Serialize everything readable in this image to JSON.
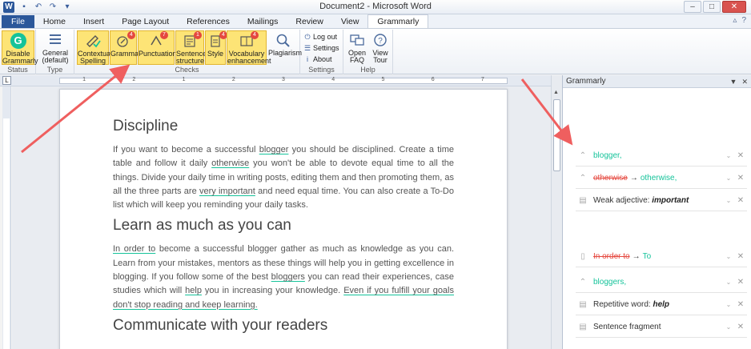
{
  "window": {
    "title": "Document2 - Microsoft Word",
    "app_icon": "W",
    "min": "–",
    "max": "□",
    "close": "✕"
  },
  "tabs": [
    "File",
    "Home",
    "Insert",
    "Page Layout",
    "References",
    "Mailings",
    "Review",
    "View",
    "Grammarly"
  ],
  "ribbon": {
    "status": {
      "label": "Status",
      "button": "Disable Grammarly",
      "button_l1": "Disable",
      "button_l2": "Grammarly"
    },
    "type": {
      "label": "Type",
      "button_l1": "General",
      "button_l2": "(default)"
    },
    "checks": {
      "label": "Checks",
      "buttons": [
        {
          "l1": "Contextual",
          "l2": "Spelling",
          "badge": ""
        },
        {
          "l1": "Grammar",
          "l2": "",
          "badge": "4"
        },
        {
          "l1": "Punctuation",
          "l2": "",
          "badge": "7"
        },
        {
          "l1": "Sentence",
          "l2": "structure",
          "badge": "1"
        },
        {
          "l1": "Style",
          "l2": "",
          "badge": "4"
        },
        {
          "l1": "Vocabulary",
          "l2": "enhancement",
          "badge": "4"
        },
        {
          "l1": "Plagiarism",
          "l2": "",
          "badge": ""
        }
      ]
    },
    "settings": {
      "label": "Settings",
      "items": [
        "Log out",
        "Settings",
        "About"
      ]
    },
    "help": {
      "label": "Help",
      "buttons": [
        {
          "l1": "Open",
          "l2": "FAQ"
        },
        {
          "l1": "View",
          "l2": "Tour"
        }
      ]
    }
  },
  "ruler_numbers": [
    "1",
    "2",
    "1",
    "2",
    "3",
    "4",
    "5",
    "6",
    "7"
  ],
  "document": {
    "h1": "Discipline",
    "p1": {
      "a": "If you want to become a successful ",
      "u1": "blogger",
      "b": " you should be disciplined. Create a time table and follow it daily ",
      "u2": "otherwise",
      "c": " you won't be able to devote equal time to all the things. Divide your daily time in writing posts, editing them and then promoting them, as all the three parts are ",
      "u3": "very important",
      "d": " and need equal time. You can also create a To-Do list which will keep you reminding  your daily tasks."
    },
    "h2": "Learn as much as you can",
    "p2": {
      "u1": "In order to",
      "a": " become a successful blogger gather as much as knowledge as you can. Learn from your mistakes, mentors as these things will help you in getting excellence in blogging. If you follow some of the best ",
      "u2": "bloggers",
      "b": " you can read their experiences, case studies which will ",
      "u3": "help",
      "c": " you in increasing your knowledge. ",
      "u4": "Even if you fulfill your goals don't stop reading and keep learning."
    },
    "h3": "Communicate with your readers"
  },
  "pane": {
    "title": "Grammarly",
    "cards": [
      {
        "icon": "punctuation-icon",
        "green": "blogger,",
        "red": "",
        "label": "",
        "bold": ""
      },
      {
        "icon": "punctuation-icon",
        "red": "otherwise",
        "green": "otherwise,",
        "label": "",
        "bold": ""
      },
      {
        "icon": "vocabulary-icon",
        "label": "Weak adjective: ",
        "bold": "important",
        "red": "",
        "green": ""
      },
      {
        "icon": "sentence-icon",
        "red": "In order to",
        "green": "To",
        "label": "",
        "bold": ""
      },
      {
        "icon": "punctuation-icon",
        "green": "bloggers,",
        "red": "",
        "label": "",
        "bold": ""
      },
      {
        "icon": "vocabulary-icon",
        "label": "Repetitive word: ",
        "bold": "help",
        "red": "",
        "green": ""
      },
      {
        "icon": "sentence-icon",
        "label": "Sentence fragment",
        "bold": "",
        "red": "",
        "green": ""
      }
    ]
  },
  "colors": {
    "grammarly_green": "#15c39a",
    "error_red": "#e5483f",
    "highlight_yellow": "#fde476",
    "word_blue": "#2b579a",
    "annotation_arrow": "#ef5f5f"
  }
}
